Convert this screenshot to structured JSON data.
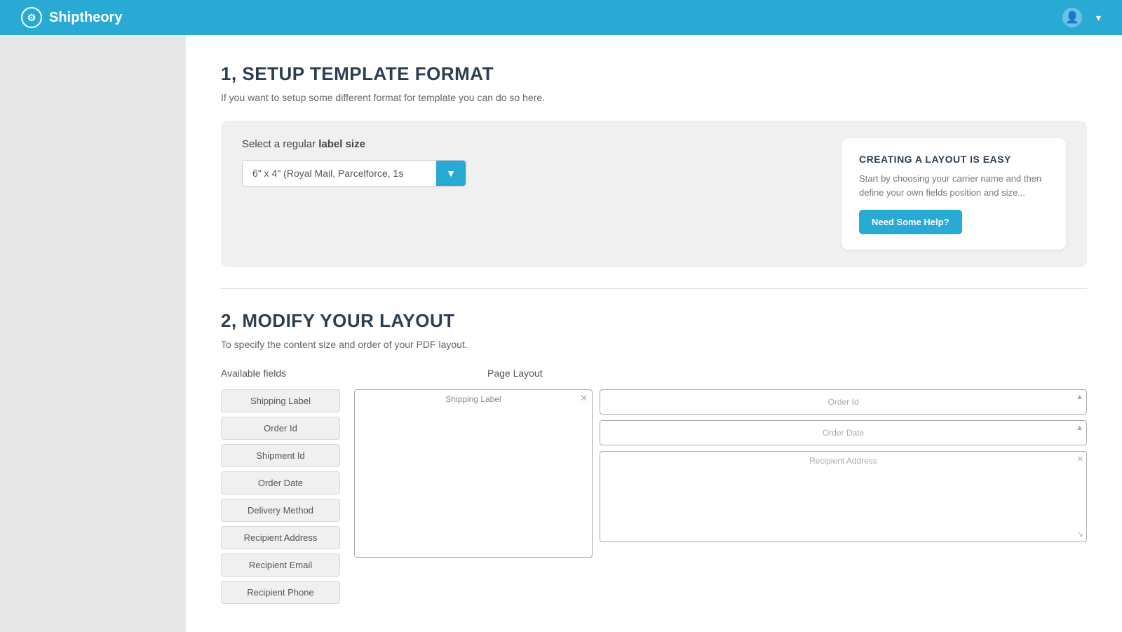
{
  "header": {
    "brand_name": "Shiptheory",
    "brand_icon": "⚙",
    "user_icon": "👤"
  },
  "section1": {
    "title": "1, SETUP TEMPLATE FORMAT",
    "description": "If you want to setup some different format for template you can do so here.",
    "label_select": {
      "label_prefix": "Select a regular ",
      "label_bold": "label size",
      "selected_value": "6\" x 4\" (Royal Mail, Parcelforce, 1s",
      "dropdown_arrow": "▼"
    },
    "help_card": {
      "title": "CREATING A LAYOUT IS EASY",
      "text": "Start by choosing your carrier name and then define your own fields position and size...",
      "button_label": "Need Some Help?"
    }
  },
  "section2": {
    "title": "2, MODIFY YOUR LAYOUT",
    "description": "To specify the content size and order of your PDF layout.",
    "col_available": "Available fields",
    "col_page": "Page Layout",
    "available_fields": [
      {
        "label": "Shipping Label"
      },
      {
        "label": "Order Id"
      },
      {
        "label": "Shipment Id"
      },
      {
        "label": "Order Date"
      },
      {
        "label": "Delivery Method"
      },
      {
        "label": "Recipient Address"
      },
      {
        "label": "Recipient Email"
      },
      {
        "label": "Recipient Phone"
      }
    ],
    "shipping_label_box": {
      "title": "Shipping Label",
      "close": "✕"
    },
    "right_fields": [
      {
        "label": "Order Id",
        "close": "▲"
      },
      {
        "label": "Order Date",
        "close": "▲"
      },
      {
        "label": "Recipient Address",
        "close": "✕",
        "large": true
      }
    ]
  }
}
